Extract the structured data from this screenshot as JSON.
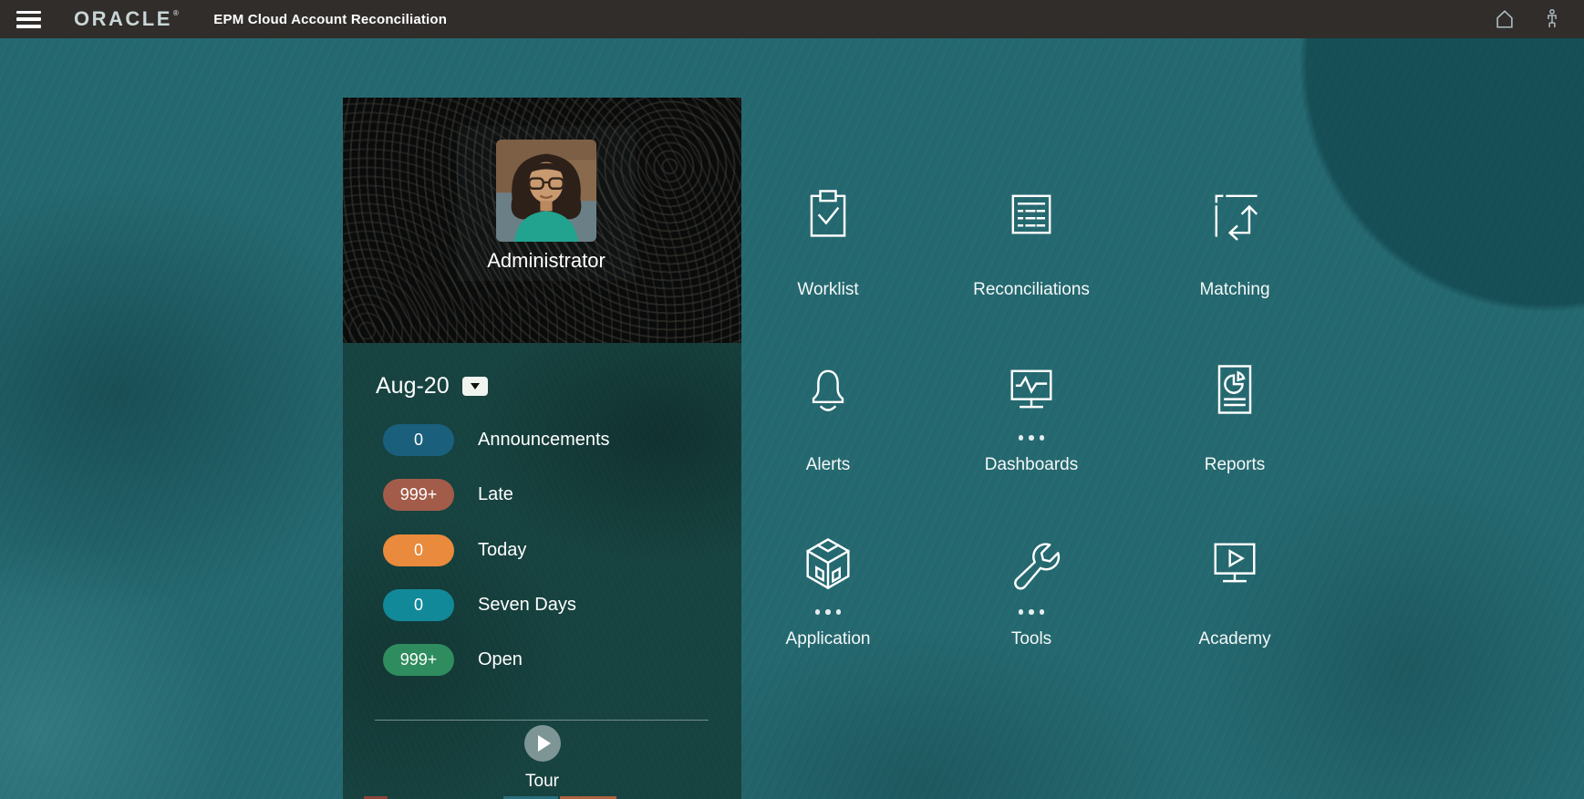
{
  "topbar": {
    "brand": "ORACLE",
    "brand_mark": "®",
    "title": "EPM Cloud Account Reconciliation"
  },
  "profile": {
    "name": "Administrator",
    "period_label": "Aug-20"
  },
  "stats": [
    {
      "count": "0",
      "label": "Announcements",
      "color": "#1A5F7C"
    },
    {
      "count": "999+",
      "label": "Late",
      "color": "#A35C4A"
    },
    {
      "count": "0",
      "label": "Today",
      "color": "#E98A3C"
    },
    {
      "count": "0",
      "label": "Seven Days",
      "color": "#128999"
    },
    {
      "count": "999+",
      "label": "Open",
      "color": "#2F8C5E"
    }
  ],
  "tour": {
    "label": "Tour"
  },
  "grid": [
    {
      "label": "Worklist"
    },
    {
      "label": "Reconciliations"
    },
    {
      "label": "Matching"
    },
    {
      "label": "Alerts"
    },
    {
      "label": "Dashboards"
    },
    {
      "label": "Reports"
    },
    {
      "label": "Application"
    },
    {
      "label": "Tools"
    },
    {
      "label": "Academy"
    }
  ],
  "colors": {
    "topbar_bg": "#312D2A",
    "main_bg": "#256970",
    "panel_black": "#0A0C0C",
    "panel_teal": "#16423F",
    "icon_stroke": "#FFFFFF"
  }
}
